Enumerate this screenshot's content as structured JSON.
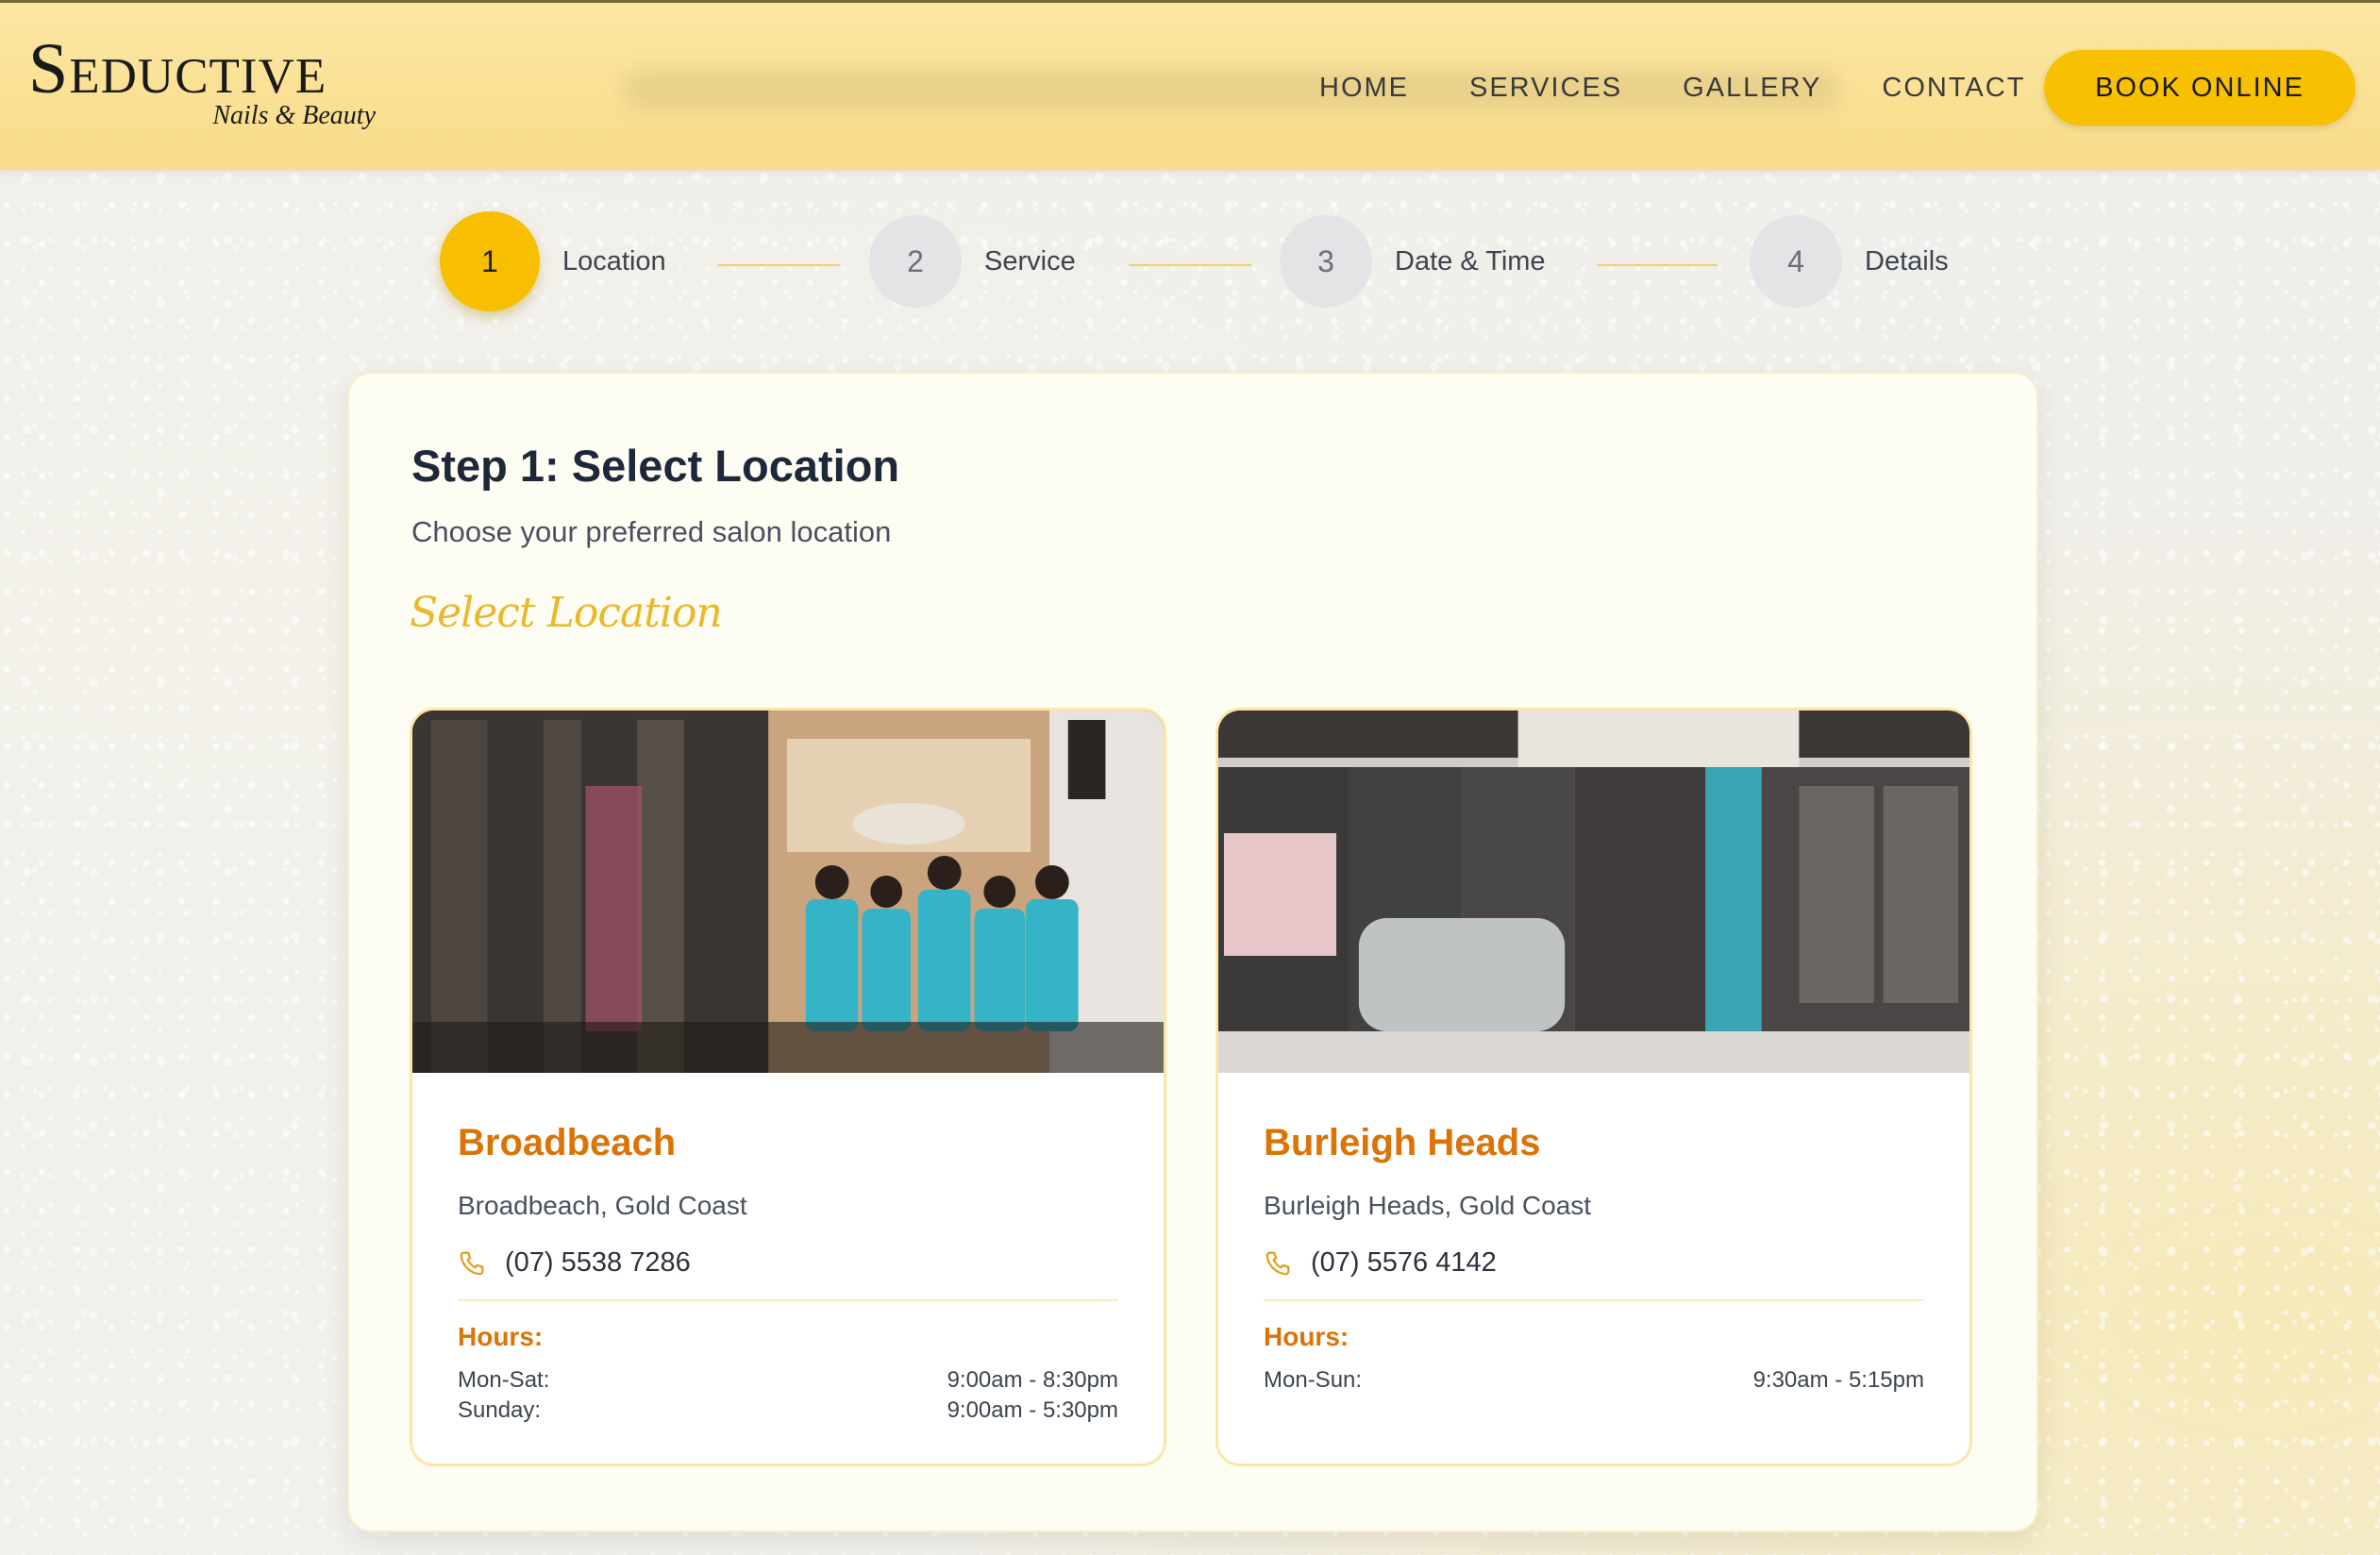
{
  "header": {
    "logo_main": "Seductive",
    "logo_sub": "Nails & Beauty",
    "nav": [
      "HOME",
      "SERVICES",
      "GALLERY",
      "CONTACT"
    ],
    "book_button": "BOOK ONLINE"
  },
  "stepper": {
    "steps": [
      {
        "number": "1",
        "label": "Location",
        "active": true
      },
      {
        "number": "2",
        "label": "Service",
        "active": false
      },
      {
        "number": "3",
        "label": "Date & Time",
        "active": false
      },
      {
        "number": "4",
        "label": "Details",
        "active": false
      }
    ]
  },
  "main": {
    "title": "Step 1: Select Location",
    "subtitle": "Choose your preferred salon location",
    "script_heading": "Select Location"
  },
  "locations": [
    {
      "name": "Broadbeach",
      "area": "Broadbeach, Gold Coast",
      "phone": "(07) 5538 7286",
      "hours_label": "Hours:",
      "hours": [
        {
          "days": "Mon-Sat:",
          "time": "9:00am - 8:30pm"
        },
        {
          "days": "Sunday:",
          "time": "9:00am - 5:30pm"
        }
      ]
    },
    {
      "name": "Burleigh Heads",
      "area": "Burleigh Heads, Gold Coast",
      "phone": "(07) 5576 4142",
      "hours_label": "Hours:",
      "hours": [
        {
          "days": "Mon-Sun:",
          "time": "9:30am - 5:15pm"
        }
      ]
    }
  ],
  "colors": {
    "accent": "#f7c000",
    "location_name": "#dc7306",
    "header_bg": "#f9dc8a"
  }
}
